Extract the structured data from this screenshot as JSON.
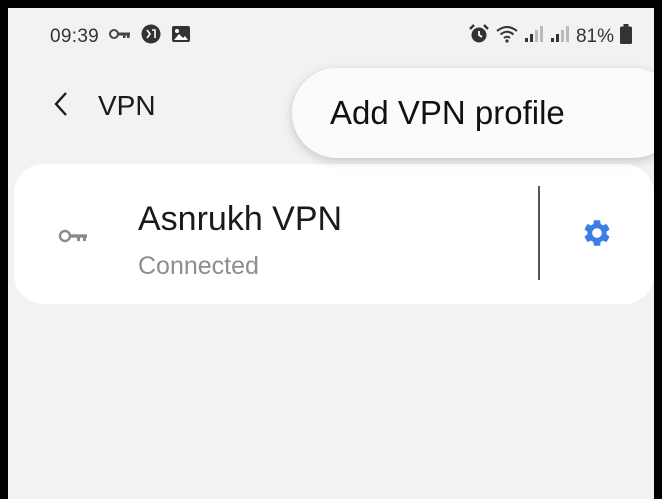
{
  "status_bar": {
    "time": "09:39",
    "battery": "81%",
    "icons": [
      "vpn-key-icon",
      "notification-badge-icon",
      "gallery-icon",
      "alarm-icon",
      "wifi-icon",
      "signal-icon",
      "signal-icon",
      "battery-icon"
    ]
  },
  "header": {
    "title": "VPN",
    "back_icon": "chevron-left-icon",
    "overflow_icon": "more-vert-icon"
  },
  "popup_menu": {
    "items": [
      {
        "label": "Add VPN profile"
      }
    ]
  },
  "vpn_list": [
    {
      "name": "Asnrukh VPN",
      "status": "Connected",
      "icon": "key-icon",
      "settings_icon": "gear-icon"
    }
  ],
  "colors": {
    "accent": "#3d7ee6",
    "background": "#f2f2f2",
    "card": "#ffffff",
    "secondary_text": "#8d8d8d"
  }
}
